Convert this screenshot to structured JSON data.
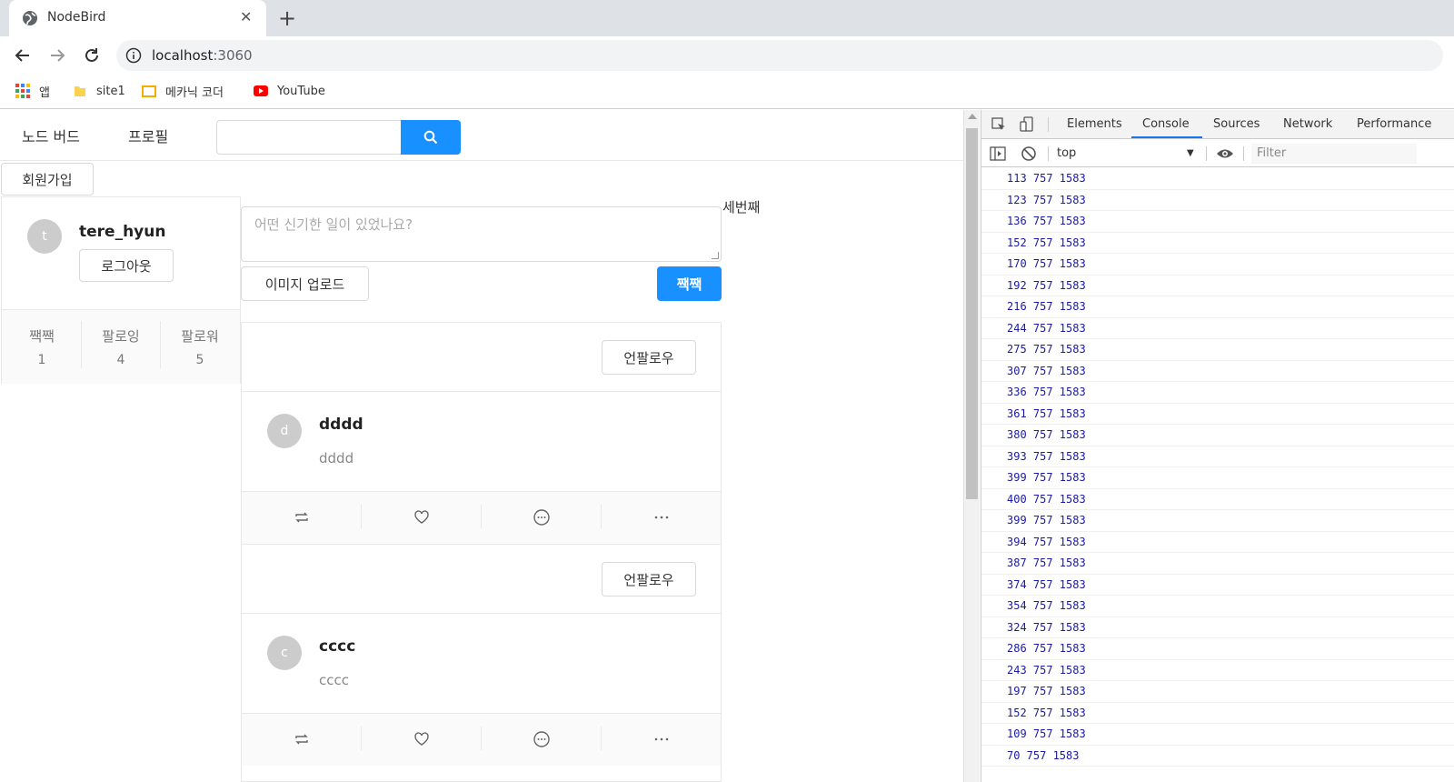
{
  "browser": {
    "tab_title": "NodeBird",
    "url_host": "localhost",
    "url_port": ":3060",
    "bookmarks": [
      "앱",
      "site1",
      "메카닉 코더",
      "YouTube"
    ]
  },
  "menu": {
    "home": "노드 버드",
    "profile": "프로필"
  },
  "signup_label": "회원가입",
  "user": {
    "avatar_letter": "t",
    "name": "tere_hyun",
    "logout_label": "로그아웃",
    "stats": [
      {
        "label": "짹짹",
        "value": "1"
      },
      {
        "label": "팔로잉",
        "value": "4"
      },
      {
        "label": "팔로워",
        "value": "5"
      }
    ]
  },
  "post_form": {
    "placeholder": "어떤 신기한 일이 있었나요?",
    "upload_label": "이미지 업로드",
    "submit_label": "짹짹"
  },
  "side_text": "세번째",
  "posts": [
    {
      "unfollow_label": "언팔로우",
      "avatar_letter": "d",
      "author": "dddd",
      "content": "dddd"
    },
    {
      "unfollow_label": "언팔로우",
      "avatar_letter": "c",
      "author": "cccc",
      "content": "cccc"
    }
  ],
  "devtools": {
    "tabs": [
      "Elements",
      "Console",
      "Sources",
      "Network",
      "Performance"
    ],
    "active_tab": "Console",
    "context": "top",
    "filter_placeholder": "Filter",
    "logs": [
      "113 757 1583",
      "123 757 1583",
      "136 757 1583",
      "152 757 1583",
      "170 757 1583",
      "192 757 1583",
      "216 757 1583",
      "244 757 1583",
      "275 757 1583",
      "307 757 1583",
      "336 757 1583",
      "361 757 1583",
      "380 757 1583",
      "393 757 1583",
      "399 757 1583",
      "400 757 1583",
      "399 757 1583",
      "394 757 1583",
      "387 757 1583",
      "374 757 1583",
      "354 757 1583",
      "324 757 1583",
      "286 757 1583",
      "243 757 1583",
      "197 757 1583",
      "152 757 1583",
      "109 757 1583",
      "70 757 1583"
    ]
  },
  "colors": {
    "primary": "#1890ff",
    "console_text": "#1a1aa6"
  }
}
